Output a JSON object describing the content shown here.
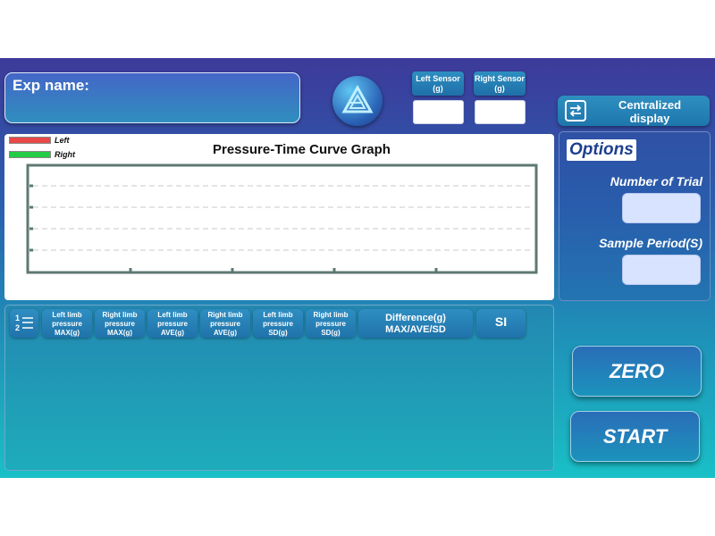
{
  "header": {
    "exp_name_label": "Exp name:",
    "left_sensor_label": "Left Sensor (g)",
    "right_sensor_label": "Right Sensor (g)",
    "left_sensor_value": "",
    "right_sensor_value": "",
    "centralized_display_label": "Centralized display"
  },
  "graph": {
    "legend_left": "Left",
    "legend_right": "Right",
    "legend_left_color": "#e84848",
    "legend_right_color": "#22cc44",
    "title": "Pressure-Time Curve Graph"
  },
  "options": {
    "title": "Options",
    "number_of_trial_label": "Number of Trial",
    "number_of_trial_value": "",
    "sample_period_label": "Sample Period(S)",
    "sample_period_value": ""
  },
  "table": {
    "list_icon": "numbered-list-icon",
    "headers": [
      "Left limb pressure MAX(g)",
      "Right limb pressure MAX(g)",
      "Left limb pressure AVE(g)",
      "Right limb pressure AVE(g)",
      "Left limb pressure SD(g)",
      "Right limb pressure SD(g)",
      "Difference(g) MAX/AVE/SD",
      "SI"
    ]
  },
  "buttons": {
    "zero": "ZERO",
    "start": "START"
  },
  "icons": {
    "logo": "triangle-logo-icon",
    "centralized": "swap-arrows-icon"
  },
  "colors": {
    "accent": "#2f8ec2"
  }
}
